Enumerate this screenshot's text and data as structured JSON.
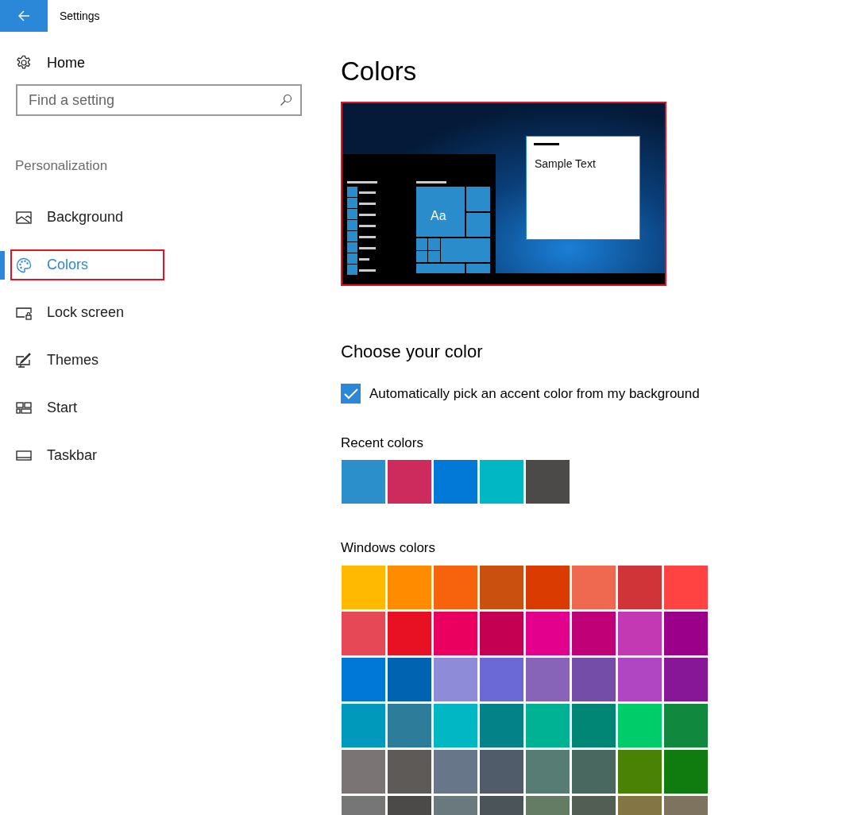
{
  "window": {
    "title": "Settings"
  },
  "sidebar": {
    "home": "Home",
    "search": {
      "placeholder": "Find a setting"
    },
    "section": "Personalization",
    "items": [
      {
        "label": "Background",
        "kind": "picture",
        "selected": false,
        "highlighted": false
      },
      {
        "label": "Colors",
        "kind": "palette",
        "selected": true,
        "highlighted": true
      },
      {
        "label": "Lock screen",
        "kind": "lock",
        "selected": false,
        "highlighted": false
      },
      {
        "label": "Themes",
        "kind": "themes",
        "selected": false,
        "highlighted": false
      },
      {
        "label": "Start",
        "kind": "start",
        "selected": false,
        "highlighted": false
      },
      {
        "label": "Taskbar",
        "kind": "taskbar",
        "selected": false,
        "highlighted": false
      }
    ]
  },
  "page": {
    "title": "Colors",
    "preview": {
      "highlighted": true,
      "tile_text": "Aa",
      "sample_text": "Sample Text"
    },
    "choose_heading": "Choose your color",
    "auto_pick": {
      "label": "Automatically pick an accent color from my background",
      "checked": true
    },
    "recent": {
      "label": "Recent colors",
      "swatches": [
        {
          "color": "#2b8fcc"
        },
        {
          "color": "#cd2b5d"
        },
        {
          "color": "#0278d7"
        },
        {
          "color": "#02b7c4"
        },
        {
          "color": "#4b4a48"
        }
      ]
    },
    "windows": {
      "label": "Windows colors",
      "swatches": [
        {
          "color": "#ffb900"
        },
        {
          "color": "#ff8c00"
        },
        {
          "color": "#f7630c"
        },
        {
          "color": "#ca5010"
        },
        {
          "color": "#da3b01"
        },
        {
          "color": "#ef6950"
        },
        {
          "color": "#d13438"
        },
        {
          "color": "#ff4343"
        },
        {
          "color": "#e74856"
        },
        {
          "color": "#e81123"
        },
        {
          "color": "#ea005e"
        },
        {
          "color": "#c30052"
        },
        {
          "color": "#e3008c"
        },
        {
          "color": "#bf0077"
        },
        {
          "color": "#c239b3"
        },
        {
          "color": "#9a0089"
        },
        {
          "color": "#0078d7"
        },
        {
          "color": "#0063b1"
        },
        {
          "color": "#8e8cd8"
        },
        {
          "color": "#6b69d6"
        },
        {
          "color": "#8764b8"
        },
        {
          "color": "#744da9"
        },
        {
          "color": "#b146c2"
        },
        {
          "color": "#881798"
        },
        {
          "color": "#0099bc"
        },
        {
          "color": "#2d7d9a"
        },
        {
          "color": "#00b7c3"
        },
        {
          "color": "#038387"
        },
        {
          "color": "#00b294"
        },
        {
          "color": "#018574"
        },
        {
          "color": "#00cc6a"
        },
        {
          "color": "#10893e"
        },
        {
          "color": "#7a7574"
        },
        {
          "color": "#5d5a58"
        },
        {
          "color": "#68768a"
        },
        {
          "color": "#515c6b"
        },
        {
          "color": "#567c73"
        },
        {
          "color": "#486860"
        },
        {
          "color": "#498205"
        },
        {
          "color": "#107c10"
        },
        {
          "color": "#767676"
        },
        {
          "color": "#4c4a48"
        },
        {
          "color": "#69797e"
        },
        {
          "color": "#4a5459"
        },
        {
          "color": "#647c64"
        },
        {
          "color": "#525e54"
        },
        {
          "color": "#847545"
        },
        {
          "color": "#7e735f"
        }
      ]
    }
  }
}
